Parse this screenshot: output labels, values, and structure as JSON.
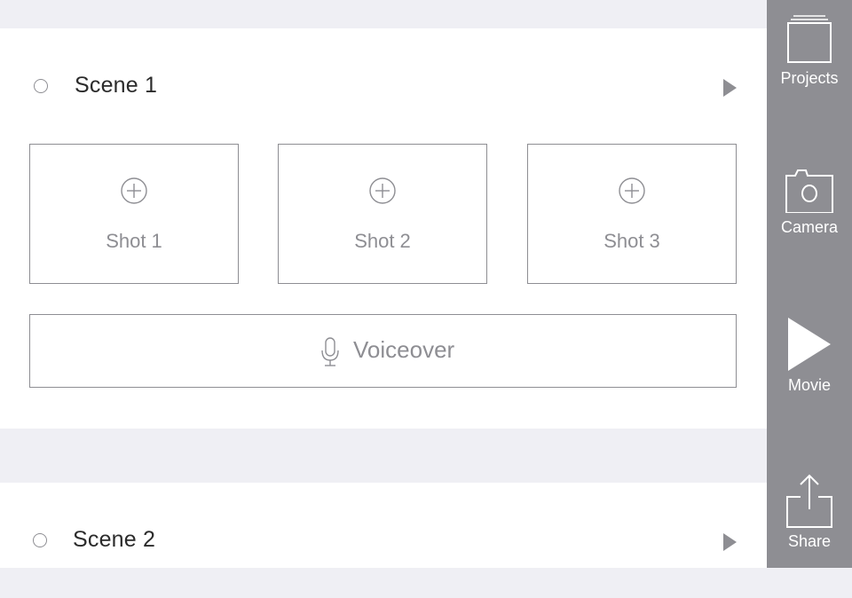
{
  "scenes": [
    {
      "title": "Scene 1",
      "shots": [
        {
          "label": "Shot 1"
        },
        {
          "label": "Shot 2"
        },
        {
          "label": "Shot 3"
        }
      ],
      "voiceover_label": "Voiceover"
    },
    {
      "title": "Scene 2"
    }
  ],
  "sidebar": {
    "projects_label": "Projects",
    "camera_label": "Camera",
    "movie_label": "Movie",
    "share_label": "Share"
  },
  "icons": {
    "scene_select": "radio-circle-icon",
    "scene_play": "play-triangle-icon",
    "add_shot": "plus-circle-icon",
    "voiceover": "microphone-icon",
    "projects": "stacked-folders-icon",
    "camera": "camera-icon",
    "movie": "play-icon",
    "share": "share-upload-icon"
  },
  "colors": {
    "background": "#efeff4",
    "card": "#ffffff",
    "sidebar": "#8e8e93",
    "outline": "#8e8e93",
    "text_dark": "#2b2b2b"
  }
}
